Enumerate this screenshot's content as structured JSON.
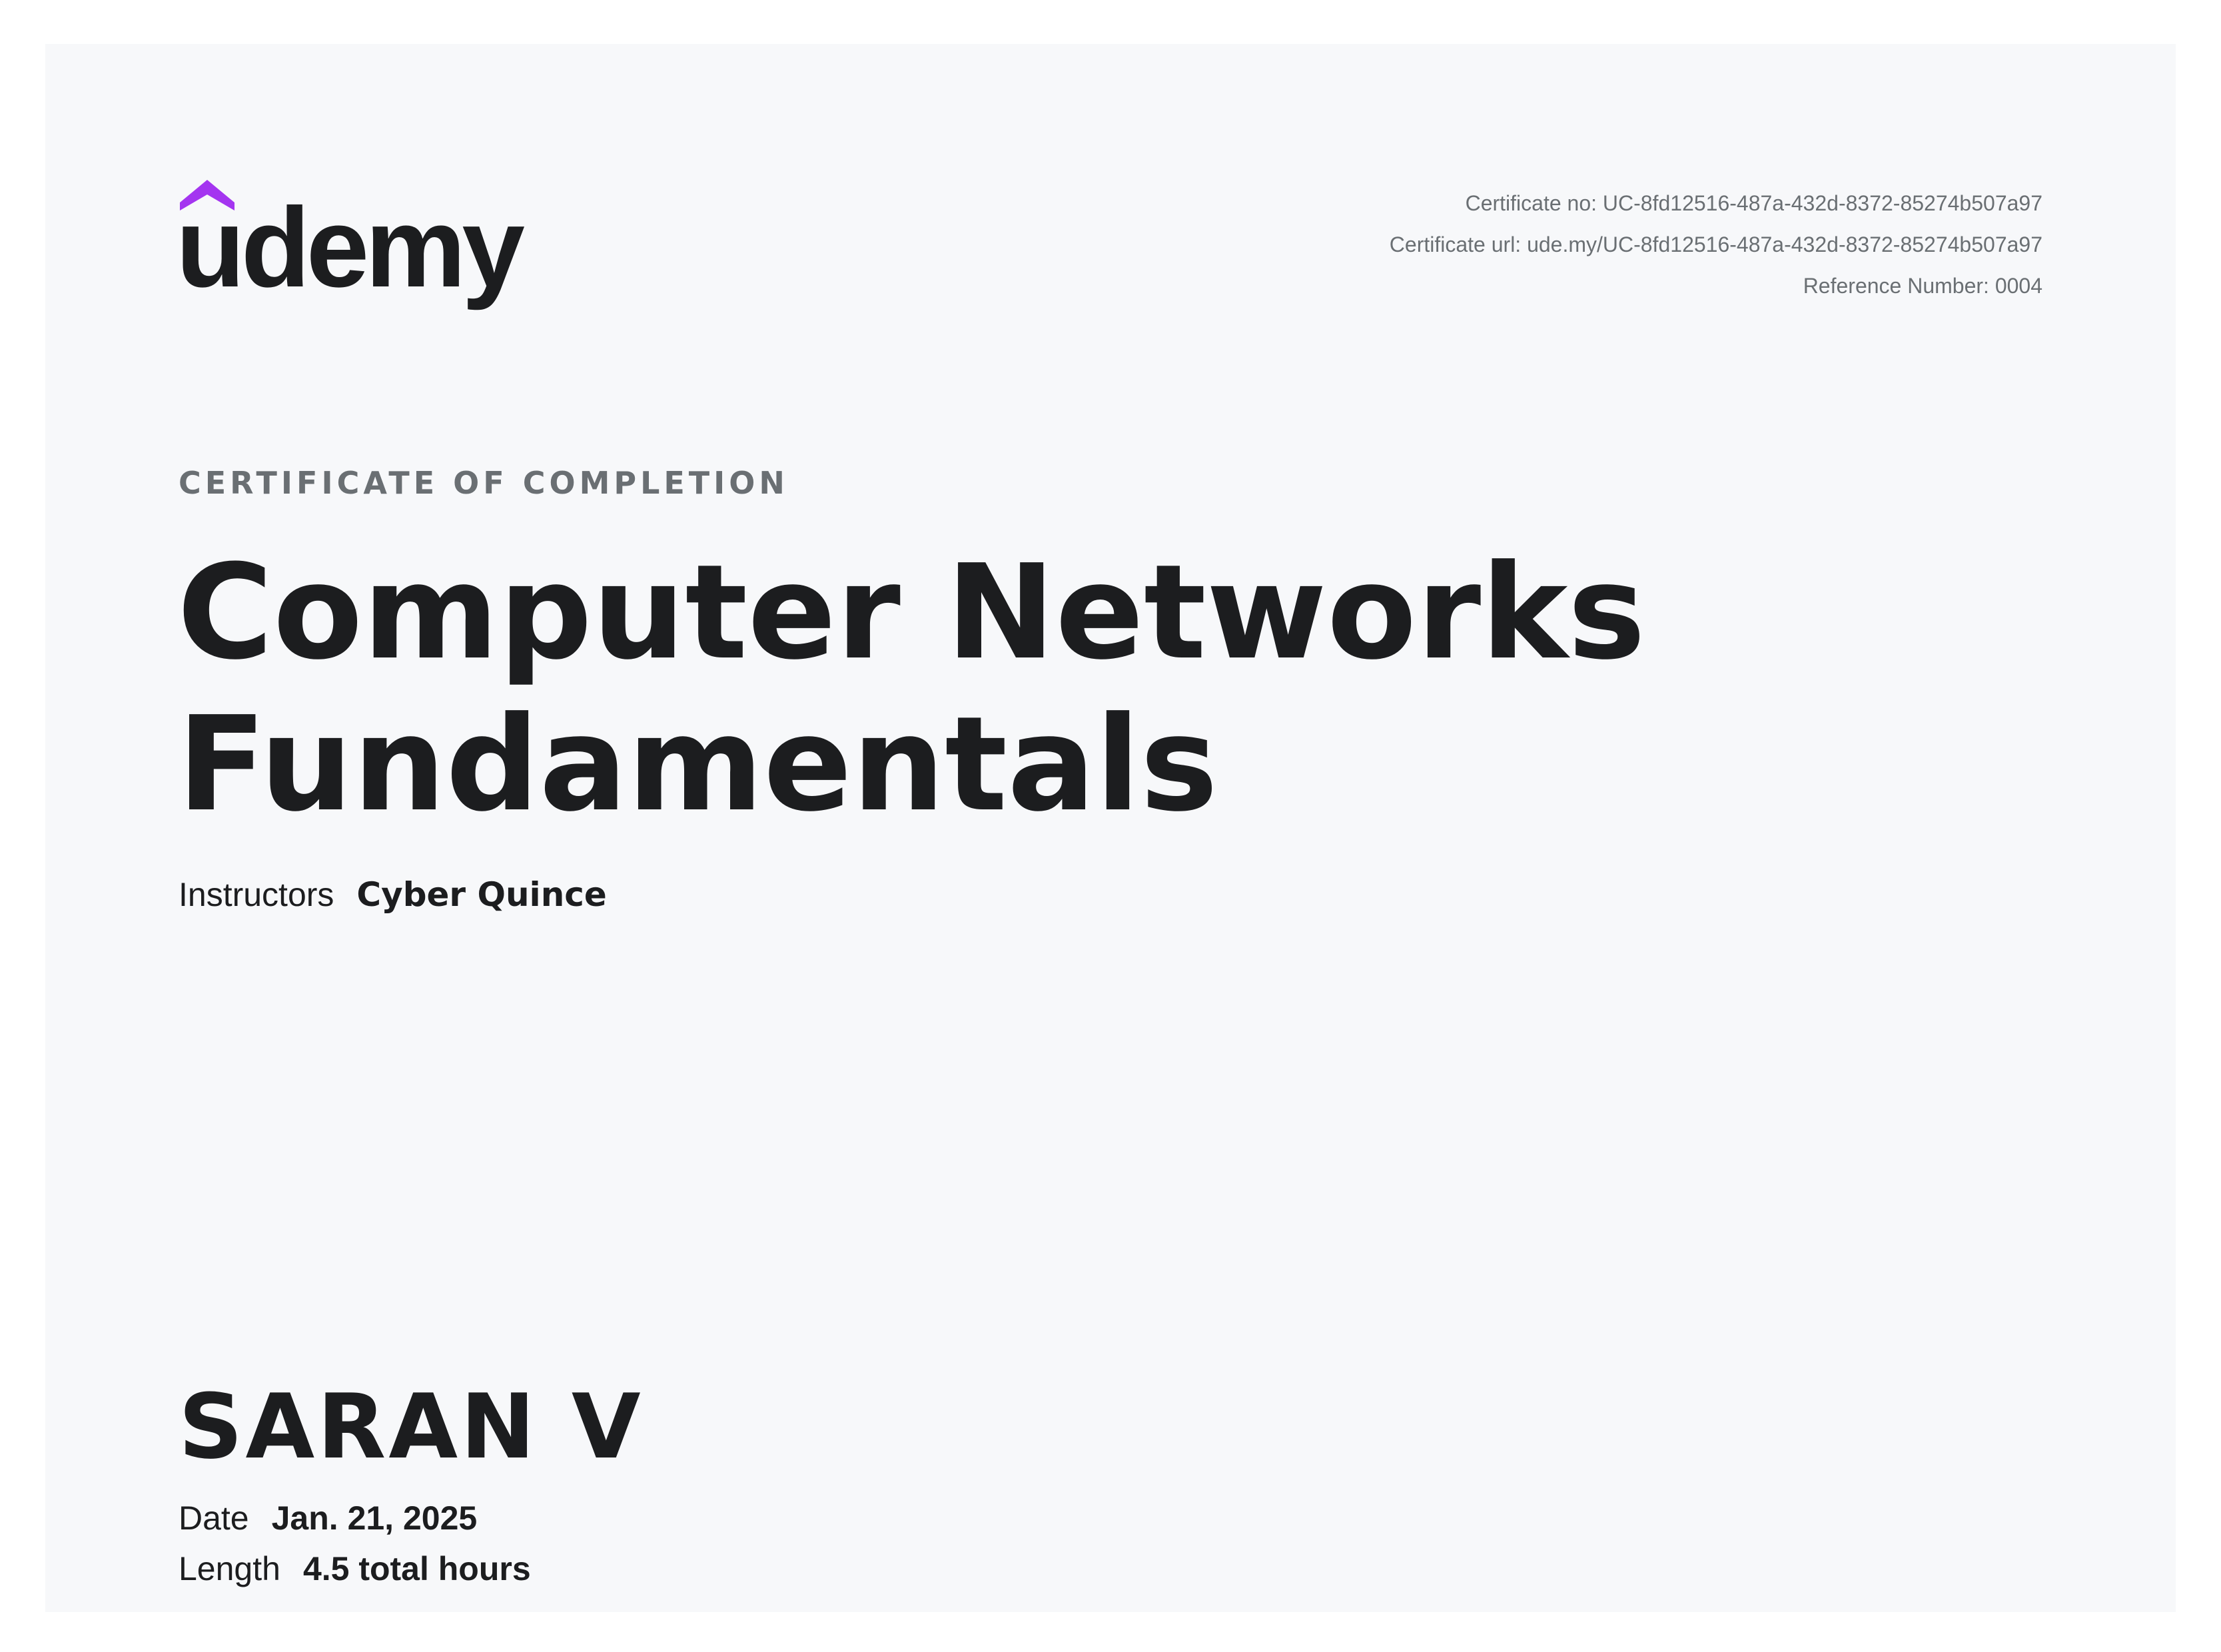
{
  "brand": {
    "logo_text": "udemy",
    "logo_icon": "udemy-hat-icon",
    "accent_color": "#a435f0",
    "text_color": "#1c1d1f"
  },
  "certificate": {
    "number_line": "Certificate no: UC-8fd12516-487a-432d-8372-85274b507a97",
    "url_line": "Certificate url: ude.my/UC-8fd12516-487a-432d-8372-85274b507a97",
    "reference_line": "Reference Number: 0004",
    "heading": "CERTIFICATE OF COMPLETION"
  },
  "course": {
    "title": "Computer Networks Fundamentals",
    "instructors_label": "Instructors",
    "instructors_value": "Cyber Quince"
  },
  "student": {
    "name": "SARAN V"
  },
  "details": {
    "date_label": "Date",
    "date_value": "Jan. 21, 2025",
    "length_label": "Length",
    "length_value": "4.5 total hours"
  }
}
